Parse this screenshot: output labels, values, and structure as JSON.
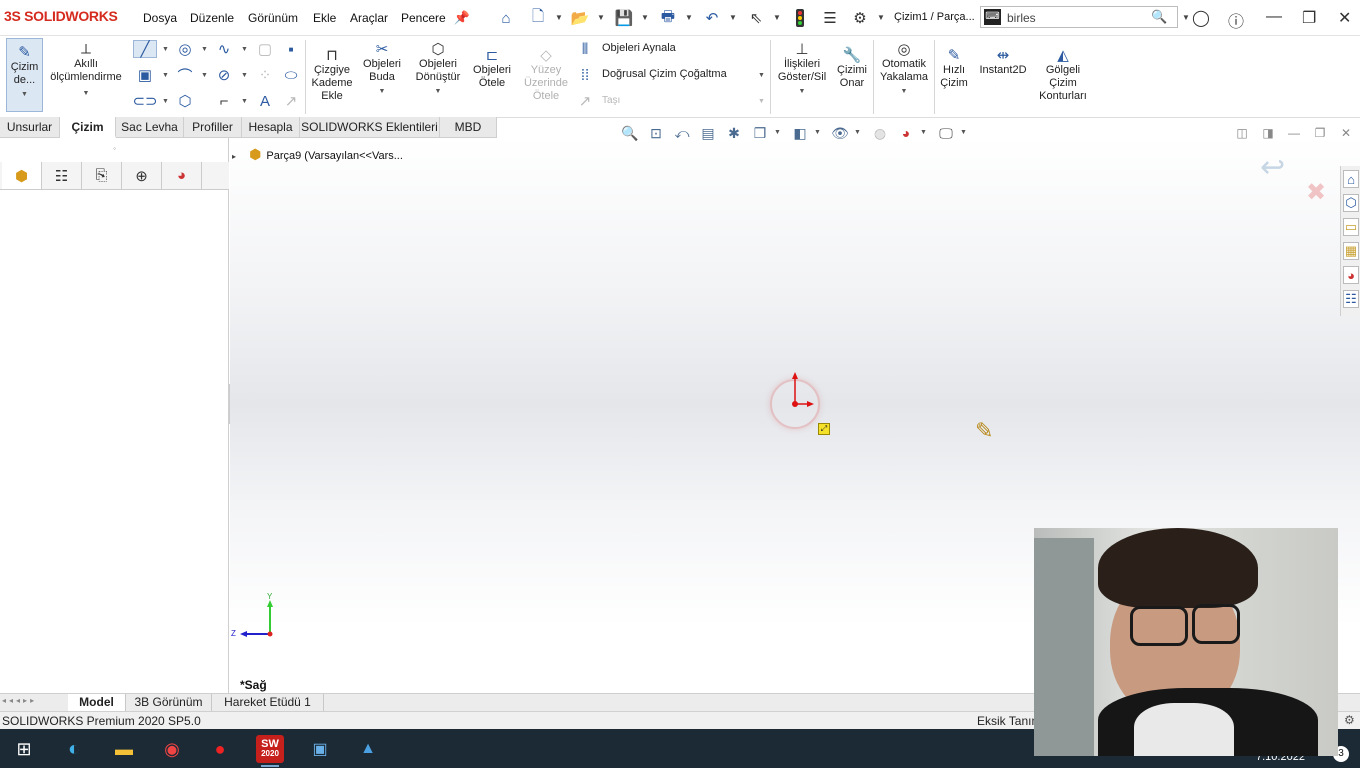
{
  "app": {
    "logo_text": "SOLIDWORKS",
    "logo_prefix": "3S"
  },
  "menubar": {
    "items": [
      "Dosya",
      "Düzenle",
      "Görünüm",
      "Ekle",
      "Araçlar",
      "Pencere"
    ]
  },
  "document_title": "Çizim1 / Parça...",
  "search": {
    "value": "birles"
  },
  "command_manager": {
    "sketch_button": "Çizim de...",
    "smart_dimension": "Akıllı ölçümlendirme",
    "offset_entities": "Çizgiye Kademe Ekle",
    "trim_entities": "Objeleri Buda",
    "convert_entities": "Objeleri Dönüştür",
    "offset_objects": "Objeleri Ötele",
    "surface_offset": "Yüzey Üzerinde Ötele",
    "mirror_entities": "Objeleri Aynala",
    "linear_pattern": "Doğrusal Çizim Çoğaltma",
    "move_entities": "Taşı",
    "relations": "İlişkileri Göster/Sil",
    "repair_sketch": "Çizimi Onar",
    "quick_snaps": "Otomatik Yakalama",
    "rapid_sketch": "Hızlı Çizim",
    "instant2d": "Instant2D",
    "shaded_contours": "Gölgeli Çizim Konturları"
  },
  "tabs": [
    "Unsurlar",
    "Çizim",
    "Sac Levha",
    "Profiller",
    "Hesapla",
    "SOLIDWORKS Eklentileri",
    "MBD"
  ],
  "active_tab": "Çizim",
  "feature_tree": {
    "root": "Parça9  (Varsayılan<<Vars..."
  },
  "viewport": {
    "view_label": "*Sağ",
    "triad": {
      "y": "Y",
      "z": "Z"
    }
  },
  "bottom_tabs": [
    "Model",
    "3B Görünüm",
    "Hareket Etüdü 1"
  ],
  "status_bar": {
    "left": "SOLIDWORKS Premium 2020 SP5.0",
    "right": "Eksik Tanım"
  },
  "taskbar": {
    "date": "7.10.2022",
    "notifications": "3",
    "solidworks_badge": "2020"
  },
  "colors": {
    "accent": "#2b5aa0",
    "logo_red": "#d52b1e",
    "taskbar_bg": "#1c2a36"
  }
}
